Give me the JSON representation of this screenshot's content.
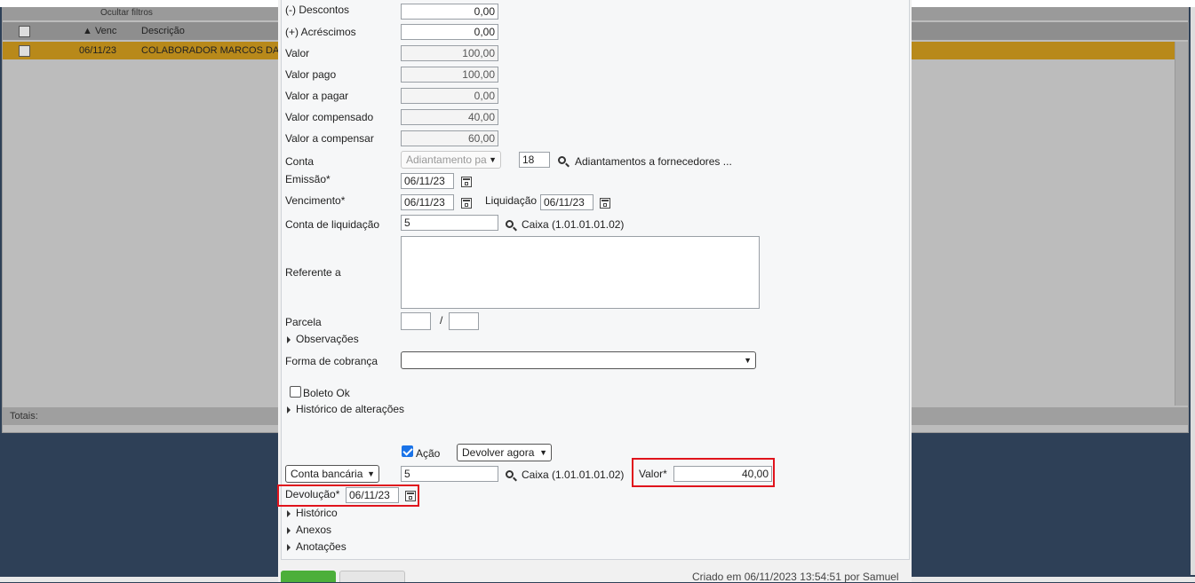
{
  "background": {
    "toolbar_label": "Ocultar filtros",
    "header": {
      "vencimento": "Venc",
      "descricao": "Descrição"
    },
    "row": {
      "vencimento": "06/11/23",
      "descricao": "COLABORADOR MARCOS DA"
    },
    "totals_label": "Totais:"
  },
  "form": {
    "descontos": {
      "label": "(-) Descontos",
      "value": "0,00"
    },
    "acrescimos": {
      "label": "(+) Acréscimos",
      "value": "0,00"
    },
    "valor": {
      "label": "Valor",
      "value": "100,00"
    },
    "valor_pago": {
      "label": "Valor pago",
      "value": "100,00"
    },
    "valor_a_pagar": {
      "label": "Valor a pagar",
      "value": "0,00"
    },
    "valor_compensado": {
      "label": "Valor compensado",
      "value": "40,00"
    },
    "valor_a_compensar": {
      "label": "Valor a compensar",
      "value": "60,00"
    },
    "conta": {
      "label": "Conta",
      "select": "Adiantamento pa",
      "code": "18",
      "description": "Adiantamentos a fornecedores ..."
    },
    "emissao": {
      "label": "Emissão*",
      "value": "06/11/23"
    },
    "vencimento": {
      "label": "Vencimento*",
      "value": "06/11/23"
    },
    "liquidacao": {
      "label": "Liquidação",
      "value": "06/11/23"
    },
    "conta_liquidacao": {
      "label": "Conta de liquidação",
      "code": "5",
      "description": "Caixa (1.01.01.01.02)"
    },
    "referente": {
      "label": "Referente a",
      "value": ""
    },
    "parcela": {
      "label": "Parcela",
      "separator": "/"
    },
    "observacoes": "Observações",
    "forma_cobranca": {
      "label": "Forma de cobrança",
      "value": ""
    },
    "boleto_ok": "Boleto Ok",
    "historico_alteracoes": "Histórico de alterações"
  },
  "acao": {
    "label": "Ação",
    "checked": true,
    "select": "Devolver agora",
    "conta_select": "Conta bancária",
    "code": "5",
    "description": "Caixa (1.01.01.01.02)",
    "valor_label": "Valor*",
    "valor": "40,00",
    "devolucao_label": "Devolução*",
    "devolucao": "06/11/23"
  },
  "sections": {
    "historico": "Histórico",
    "anexos": "Anexos",
    "anotacoes": "Anotações"
  },
  "footer": {
    "created": "Criado em 06/11/2023 13:54:51 por Samuel"
  },
  "colors": {
    "highlight": "#e0131c",
    "selected_row": "#b8891a",
    "save_button": "#4caf3a"
  }
}
